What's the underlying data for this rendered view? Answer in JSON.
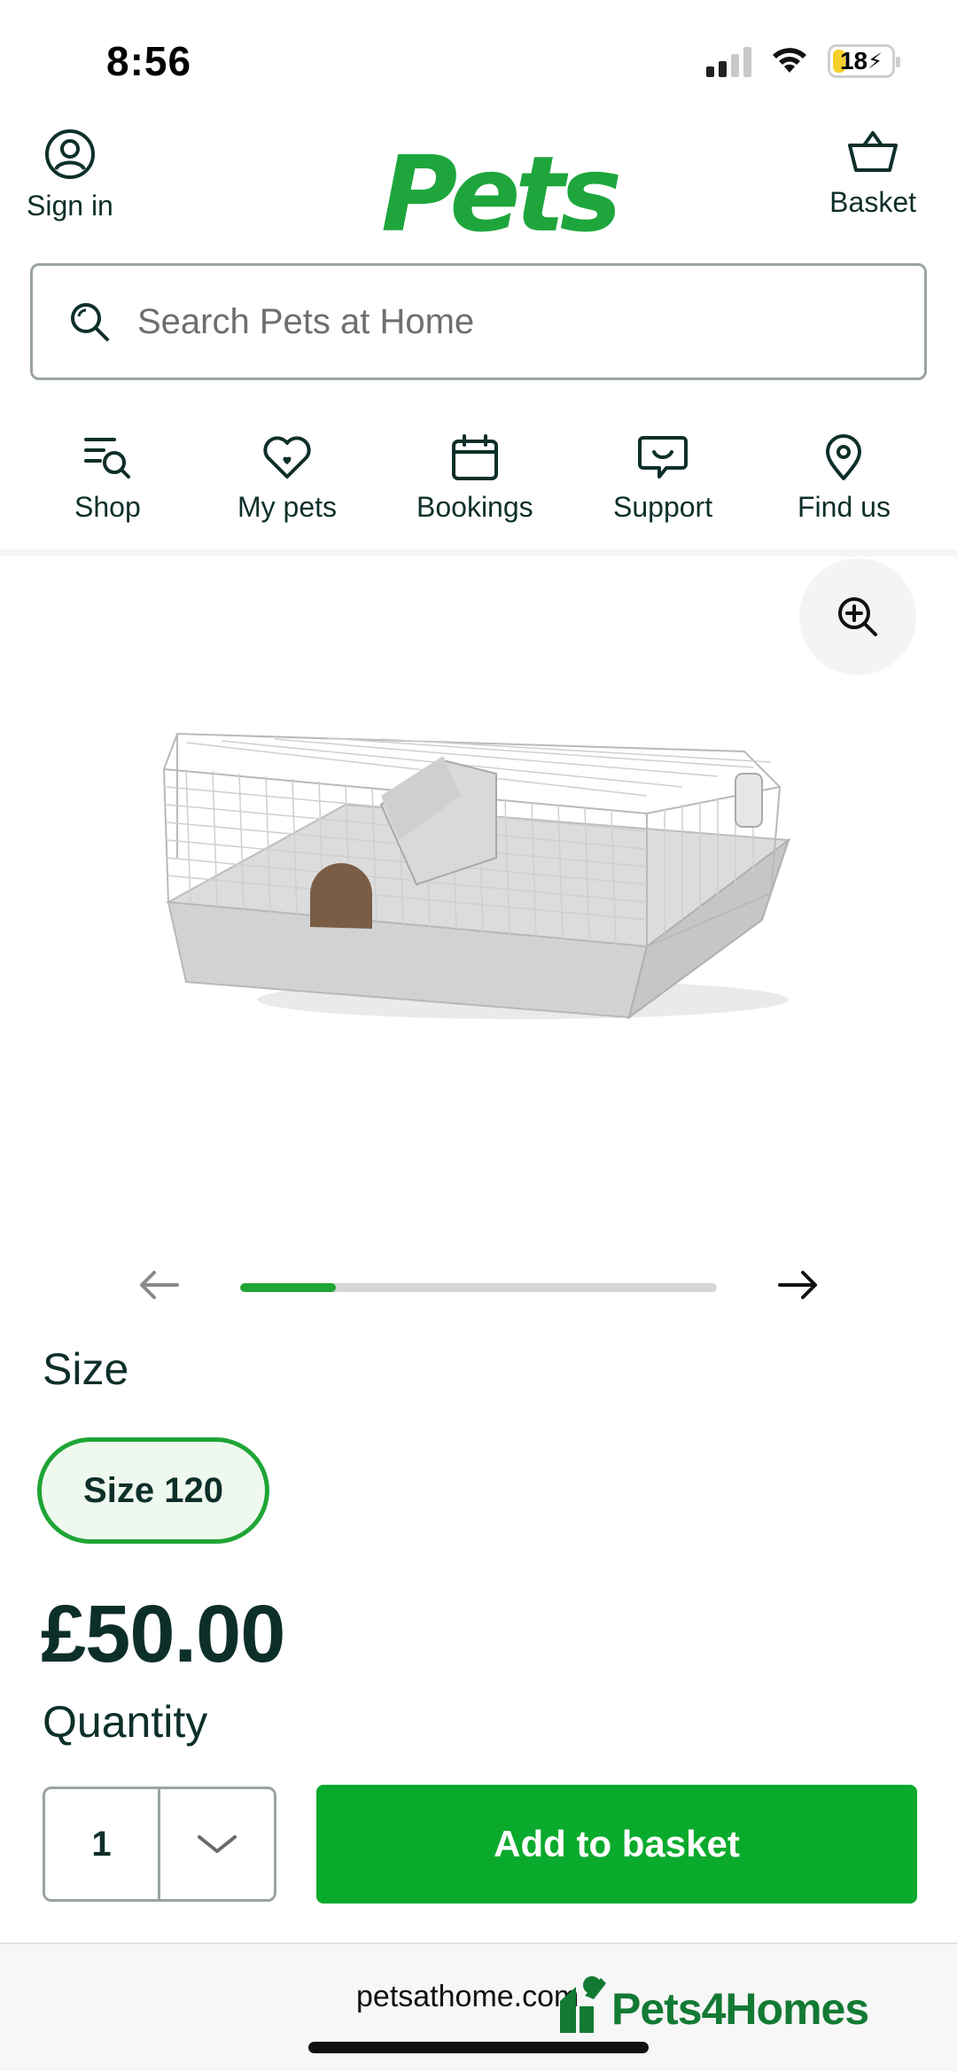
{
  "status_bar": {
    "time": "8:56",
    "battery": "18"
  },
  "header": {
    "sign_in_label": "Sign in",
    "logo_text": "Pets",
    "basket_label": "Basket"
  },
  "search": {
    "placeholder": "Search Pets at Home"
  },
  "nav": {
    "items": [
      {
        "label": "Shop",
        "icon": "shop-search-icon"
      },
      {
        "label": "My pets",
        "icon": "heart-paw-icon"
      },
      {
        "label": "Bookings",
        "icon": "calendar-icon"
      },
      {
        "label": "Support",
        "icon": "chat-bubble-icon"
      },
      {
        "label": "Find us",
        "icon": "location-pin-icon"
      }
    ]
  },
  "gallery": {
    "image_progress": 0.2
  },
  "product": {
    "size_label": "Size",
    "size_option": "Size 120",
    "price": "£50.00",
    "quantity_label": "Quantity",
    "quantity_value": "1",
    "add_to_basket_label": "Add to basket"
  },
  "browser": {
    "url": "petsathome.com"
  },
  "watermark": {
    "text": "Pets4Homes"
  },
  "colors": {
    "brand_green": "#1ea63d",
    "button_green": "#0aaa2d",
    "text_dark": "#0d2f2a",
    "battery_yellow": "#f7cf2b"
  }
}
